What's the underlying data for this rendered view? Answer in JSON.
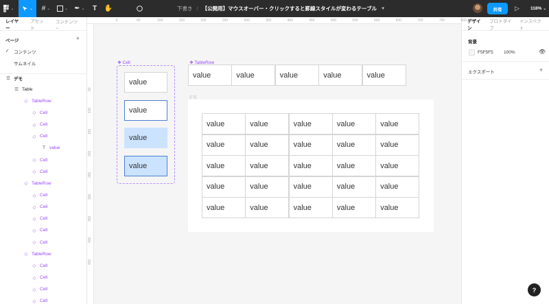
{
  "topbar": {
    "title_draft": "下書き",
    "title_separator": "/",
    "file_name": "【公開用】マウスオーバー・クリックすると罫線スタイルが変わるテーブル",
    "share_label": "共有",
    "zoom_label": "118%"
  },
  "left_panel": {
    "tabs": [
      "レイヤー",
      "アセット",
      "コンテンツ"
    ],
    "pages_header": "ページ",
    "pages": [
      {
        "label": "コンテンツ",
        "selected": true
      },
      {
        "label": "サムネイル",
        "selected": false
      }
    ],
    "layers": [
      {
        "label": "デモ",
        "icon": "frame-icon",
        "indent": 0
      },
      {
        "label": "Table",
        "icon": "frame-icon",
        "indent": 1
      },
      {
        "label": "TableRow",
        "icon": "instance-icon",
        "indent": 2
      },
      {
        "label": "Cell",
        "icon": "instance-icon",
        "indent": 3
      },
      {
        "label": "Cell",
        "icon": "instance-icon",
        "indent": 3
      },
      {
        "label": "Cell",
        "icon": "instance-icon",
        "indent": 3
      },
      {
        "label": "value",
        "icon": "text-icon",
        "indent": 4
      },
      {
        "label": "Cell",
        "icon": "instance-icon",
        "indent": 3
      },
      {
        "label": "Cell",
        "icon": "instance-icon",
        "indent": 3
      },
      {
        "label": "TableRow",
        "icon": "instance-icon",
        "indent": 2
      },
      {
        "label": "Cell",
        "icon": "instance-icon",
        "indent": 3
      },
      {
        "label": "Cell",
        "icon": "instance-icon",
        "indent": 3
      },
      {
        "label": "Cell",
        "icon": "instance-icon",
        "indent": 3
      },
      {
        "label": "Cell",
        "icon": "instance-icon",
        "indent": 3
      },
      {
        "label": "Cell",
        "icon": "instance-icon",
        "indent": 3
      },
      {
        "label": "TableRow",
        "icon": "instance-icon",
        "indent": 2
      },
      {
        "label": "Cell",
        "icon": "instance-icon",
        "indent": 3
      },
      {
        "label": "Cell",
        "icon": "instance-icon",
        "indent": 3
      },
      {
        "label": "Cell",
        "icon": "instance-icon",
        "indent": 3
      },
      {
        "label": "Cell",
        "icon": "instance-icon",
        "indent": 3
      }
    ]
  },
  "right_panel": {
    "tabs": [
      "デザイン",
      "プロトタイプ",
      "インスペクト"
    ],
    "background_label": "背景",
    "background_hex": "F5F5F5",
    "background_opacity": "100%",
    "export_label": "エクスポート"
  },
  "rulers": {
    "horizontal": [
      "0",
      "50",
      "100",
      "150",
      "200",
      "250",
      "300",
      "350",
      "400",
      "450",
      "500",
      "550",
      "600",
      "650",
      "700",
      "750",
      "800"
    ],
    "vertical": [
      "50",
      "100",
      "150",
      "200",
      "250",
      "300",
      "350",
      "400",
      "450"
    ]
  },
  "canvas": {
    "cell_component_label": "Cell",
    "tablerow_component_label": "TableRow",
    "demo_frame_label": "デモ",
    "cell_variants": [
      "value",
      "value",
      "value",
      "value"
    ],
    "tablerow_cells": [
      "value",
      "value",
      "value",
      "value",
      "value"
    ],
    "table_rows": [
      [
        "value",
        "value",
        "value",
        "value",
        "value"
      ],
      [
        "value",
        "value",
        "value",
        "value",
        "value"
      ],
      [
        "value",
        "value",
        "value",
        "value",
        "value"
      ],
      [
        "value",
        "value",
        "value",
        "value",
        "value"
      ],
      [
        "value",
        "value",
        "value",
        "value",
        "value"
      ]
    ]
  },
  "colors": {
    "accent": "#0d99ff",
    "component": "#9747ff",
    "hover_fill": "#cce3ff",
    "selected_border": "#4a7fd4"
  }
}
